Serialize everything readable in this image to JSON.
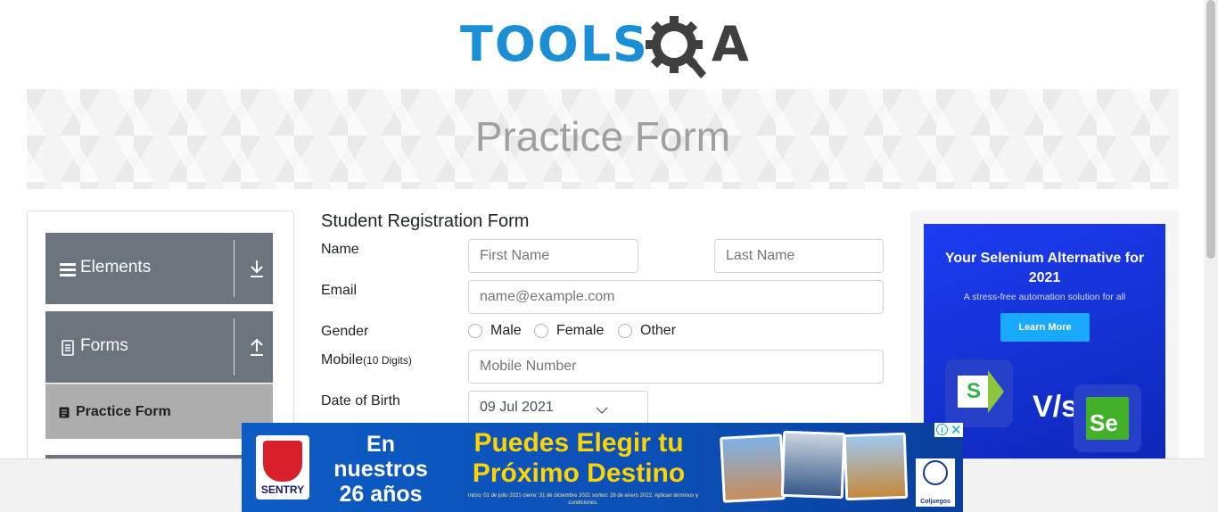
{
  "header": {
    "logo_tools": "TOOLS",
    "logo_a": "A",
    "logo_colors": {
      "tools": "#1a8fd6",
      "qa": "#3f3f3f"
    }
  },
  "banner": {
    "title": "Practice Form"
  },
  "sidebar": {
    "groups": [
      {
        "label": "Elements",
        "icon": "hamburger-icon",
        "toggle_icon": "download-arrow-icon"
      },
      {
        "label": "Forms",
        "icon": "document-icon",
        "toggle_icon": "upload-arrow-icon"
      }
    ],
    "active_item": {
      "label": "Practice Form",
      "icon": "form-icon"
    },
    "colors": {
      "group_bg": "#6c757d",
      "active_bg": "#adadad"
    }
  },
  "form": {
    "title": "Student Registration Form",
    "name_label": "Name",
    "first_name_placeholder": "First Name",
    "last_name_placeholder": "Last Name",
    "email_label": "Email",
    "email_placeholder": "name@example.com",
    "gender_label": "Gender",
    "gender_options": [
      "Male",
      "Female",
      "Other"
    ],
    "mobile_label": "Mobile",
    "mobile_hint": "(10 Digits)",
    "mobile_placeholder": "Mobile Number",
    "dob_label": "Date of Birth",
    "dob_value": "09 Jul 2021"
  },
  "side_ad": {
    "headline": "Your Selenium Alternative for 2021",
    "subtext": "A stress-free automation solution for all",
    "button": "Learn More",
    "vs": "V/s",
    "logo_left": "S",
    "logo_right": "Se"
  },
  "bottom_ad": {
    "badge": "SENTRY",
    "years": "En nuestros 26 años",
    "promo": "Puedes Elegir tu Próximo Destino",
    "fine_print": "Inicio: 01 de julio 2021 cierre: 31 de diciembre 2021 sorteo: 28 de enero 2022. Aplican términos y condiciones.",
    "seal": "Coljuegos",
    "close": "✕",
    "info": "i"
  }
}
